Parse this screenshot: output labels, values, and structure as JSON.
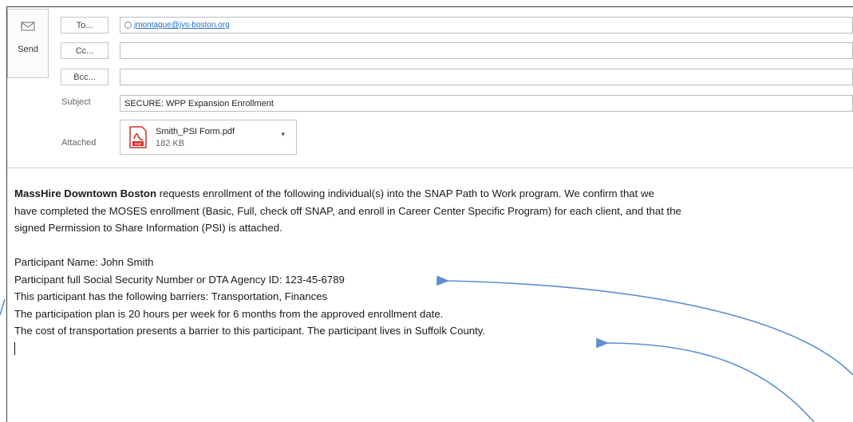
{
  "compose": {
    "send_label": "Send",
    "to_button": "To...",
    "cc_button": "Cc...",
    "bcc_button": "Bcc...",
    "to_recipient": "jmontague@jvs-boston.org",
    "cc_value": "",
    "bcc_value": "",
    "subject_label": "Subject",
    "subject_value": "SECURE: WPP Expansion Enrollment",
    "attached_label": "Attached",
    "attachment": {
      "name": "Smith_PSI Form.pdf",
      "size": "182 KB",
      "icon": "pdf-icon"
    }
  },
  "body": {
    "org_name": "MassHire Downtown Boston",
    "intro_line1": " requests enrollment of the following individual(s) into the SNAP Path to Work program. We confirm that we",
    "intro_line2": "have completed the MOSES enrollment (Basic, Full, check off SNAP, and enroll in Career Center Specific Program) for each client, and that the",
    "intro_line3": "signed Permission to Share Information (PSI) is attached.",
    "line_name": "Participant Name: John Smith",
    "line_ssn": "Participant full Social Security Number or DTA Agency ID: 123-45-6789",
    "line_barriers": "This participant has the following barriers: Transportation, Finances",
    "line_plan": "The participation plan is 20 hours per week for 6 months from the approved enrollment date.",
    "line_transport": "The cost of transportation presents a barrier to this participant. The participant lives in Suffolk County."
  },
  "colors": {
    "arrow": "#5b8fcf",
    "link": "#1f6fbf",
    "pdf_red": "#d0312d"
  }
}
